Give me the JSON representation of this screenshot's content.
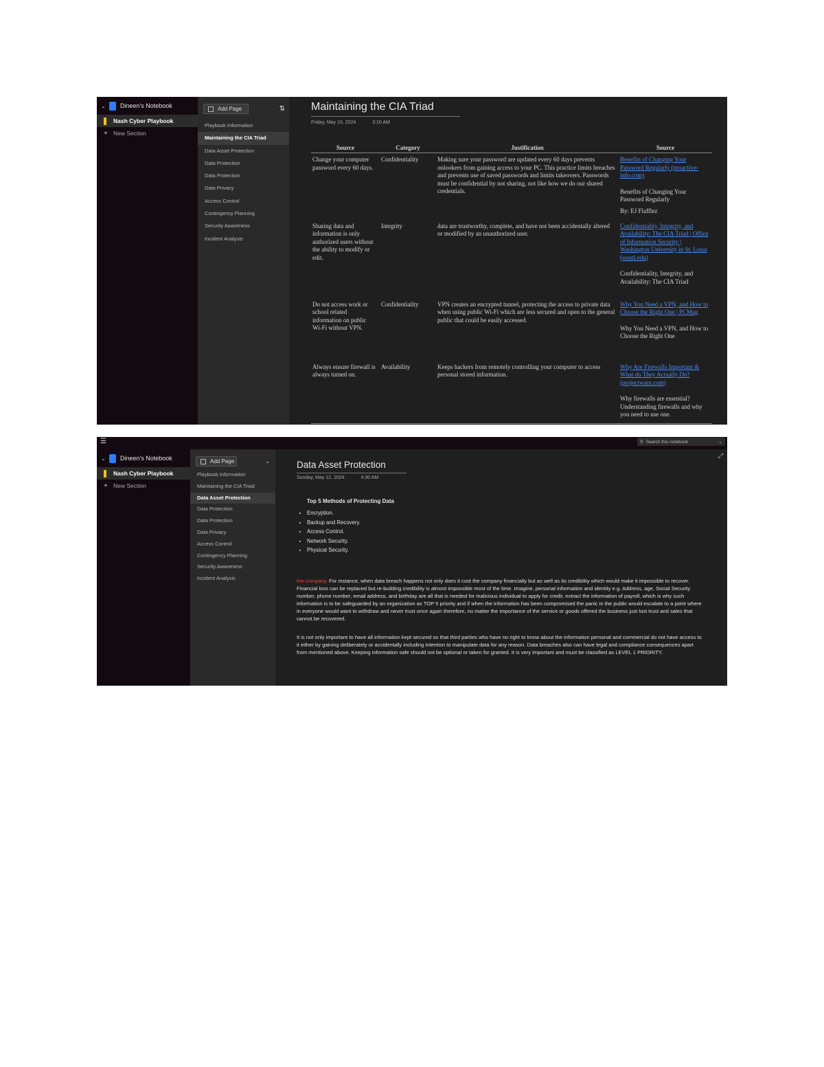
{
  "screenshot1": {
    "notebook_name": "Dineen's Notebook",
    "sections": [
      {
        "label": "Nash Cyber Playbook",
        "active": true
      },
      {
        "label": "New Section",
        "active": false,
        "is_add": true
      }
    ],
    "add_page_label": "Add Page",
    "pages": [
      {
        "label": "Playbook Information",
        "active": false
      },
      {
        "label": "Maintaining the CIA Triad",
        "active": true
      },
      {
        "label": "Data Asset Protection",
        "active": false
      },
      {
        "label": "Data Protection",
        "active": false
      },
      {
        "label": "Data Protection",
        "active": false
      },
      {
        "label": "Data Privacy",
        "active": false
      },
      {
        "label": "Access Control",
        "active": false
      },
      {
        "label": "Contingency Planning",
        "active": false
      },
      {
        "label": "Security Awareness",
        "active": false
      },
      {
        "label": "Incident Analysis",
        "active": false
      }
    ],
    "page_title": "Maintaining the CIA Triad",
    "page_date": "Friday, May 10, 2024",
    "page_time": "3:10 AM",
    "table": {
      "headers": [
        "Source",
        "Category",
        "Justification",
        "Source"
      ],
      "rows": [
        {
          "source": "Change your computer password every 60 days.",
          "category": "Confidentiality",
          "justification": "Making sure your password are updated every 60 days prevents onlookers from gaining access to your PC. This practice limits breaches and prevents use of saved passwords and limits takeovers. Passwords must be confidential by not sharing, not like how we do our shared credentials.",
          "link": "Benefits of Changing Your Password Regularly (proactive-info.com)",
          "ref_title": "Benefits of Changing Your Password Regularly",
          "ref_author": "By: EJ Flafflez"
        },
        {
          "source": "Sharing data and information is only authorized users without the ability to modify or edit.",
          "category": "Integrity",
          "justification": "data are trustworthy, complete, and have not been accidentally altered or modified by an unauthorized user.",
          "link": "Confidentiality, Integrity, and Availability: The CIA Triad | Office of Information Security | Washington University in St. Louis (wustl.edu)",
          "ref_title": "Confidentiality, Integrity, and Availability: The CIA Triad",
          "ref_author": ""
        },
        {
          "source": "Do not access work or school related information on public Wi-Fi without VPN.",
          "category": "Confidentiality",
          "justification": "VPN creates an encrypted tunnel, protecting the access to private data when using public Wi-Fi which are less secured and open to the general public that could be easily accessed.",
          "link": "Why You Need a VPN, and How to Choose the Right One | PCMag",
          "ref_title": "Why You Need a VPN, and How to Choose the Right One",
          "ref_author": ""
        },
        {
          "source": "Always ensure firewall is always turned on.",
          "category": "Availability",
          "justification": "Keeps hackers from remotely controlling your computer to access personal stored information.",
          "link": "Why Are Firewalls Important & What do They Actually Do? (projectwarn.com)",
          "ref_title": "Why firewalls are essential? Understanding firewalls and why you need to use one.",
          "ref_author": ""
        }
      ]
    }
  },
  "screenshot2": {
    "menu_icon": "hamburger-icon",
    "search_placeholder": "Search this notebook",
    "notebook_name": "Dineen's Notebook",
    "sections": [
      {
        "label": "Nash Cyber Playbook",
        "active": true
      },
      {
        "label": "New Section",
        "active": false,
        "is_add": true
      }
    ],
    "add_page_label": "Add Page",
    "pages": [
      {
        "label": "Playbook Information",
        "active": false
      },
      {
        "label": "Maintaining the CIA Triad",
        "active": false
      },
      {
        "label": "Data Asset Protection",
        "active": true
      },
      {
        "label": "Data Protection",
        "active": false
      },
      {
        "label": "Data Protection",
        "active": false
      },
      {
        "label": "Data Privacy",
        "active": false
      },
      {
        "label": "Access Control",
        "active": false
      },
      {
        "label": "Contingency Planning",
        "active": false
      },
      {
        "label": "Security Awareness",
        "active": false
      },
      {
        "label": "Incident Analysis",
        "active": false
      }
    ],
    "page_title": "Data Asset Protection",
    "page_date": "Sunday, May 12, 2024",
    "page_time": "4:30 AM",
    "methods_heading": "Top 5 Methods of Protecting Data",
    "methods": [
      "Encryption.",
      "Backup and Recovery.",
      "Access Control.",
      "Network Security.",
      "Physical Security."
    ],
    "para1_start": "the company.",
    "para1_rest": " For instance, when data breach happens not only does it cost the company financially but as well as its credibility which would make it impossible to recover. Financial loss can be replaced but re-building credibility is almost impossible most of the time. Imagine, personal information and identity e.g. Address, age, Social Security number, phone number, email address, and birthday are all that is needed for malicious individual to apply for credit, extract the information of payroll, which is why such information is to be safeguarded by an organization as TOP 5 priority and if when the information has been compromised the panic in the public would escalate to a point where in everyone would want to withdraw and never trust once again therefore, no matter the importance of the service or goods offered the business just lost trust and sales that cannot be recovered.",
    "para2": "It is not only important to have all information kept secured so that third parties who have no right to know about the information personal and commercial do not have access to it either by gaining deliberately or accidentally including intention to manipulate data for any reason. Data breaches also can have legal and compliance consequences apart from mentioned above. Keeping information safe should not be optional or taken for granted. It is very important and must be classified as LEVEL 1 PRIORITY.",
    "colors": {
      "accent_red": "#e04848",
      "tab_yellow": "#f4c21b",
      "notebook_blue": "#2f7cf6",
      "link_blue": "#4c8fff"
    }
  }
}
